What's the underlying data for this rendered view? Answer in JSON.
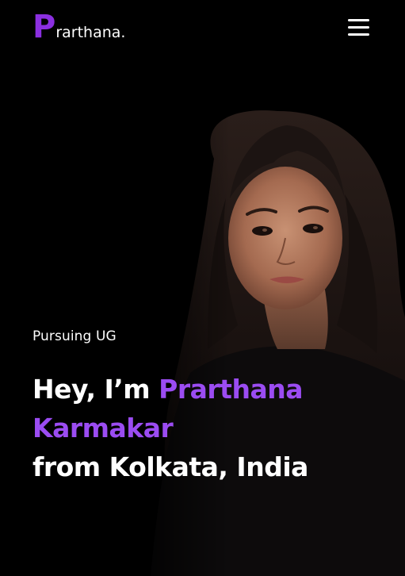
{
  "header": {
    "logo_initial": "P",
    "logo_rest": "rarthana.",
    "menu_icon": "hamburger-menu-icon"
  },
  "hero": {
    "subtitle": "Pursuing UG",
    "greeting_prefix": "Hey, I’m ",
    "first_name": "Prarthana",
    "last_name": "Karmakar",
    "location_line": "from Kolkata, India",
    "accent_color": "#9b4cf2",
    "background_color": "#000000"
  },
  "portrait": {
    "description_icon": "portrait-photo"
  }
}
